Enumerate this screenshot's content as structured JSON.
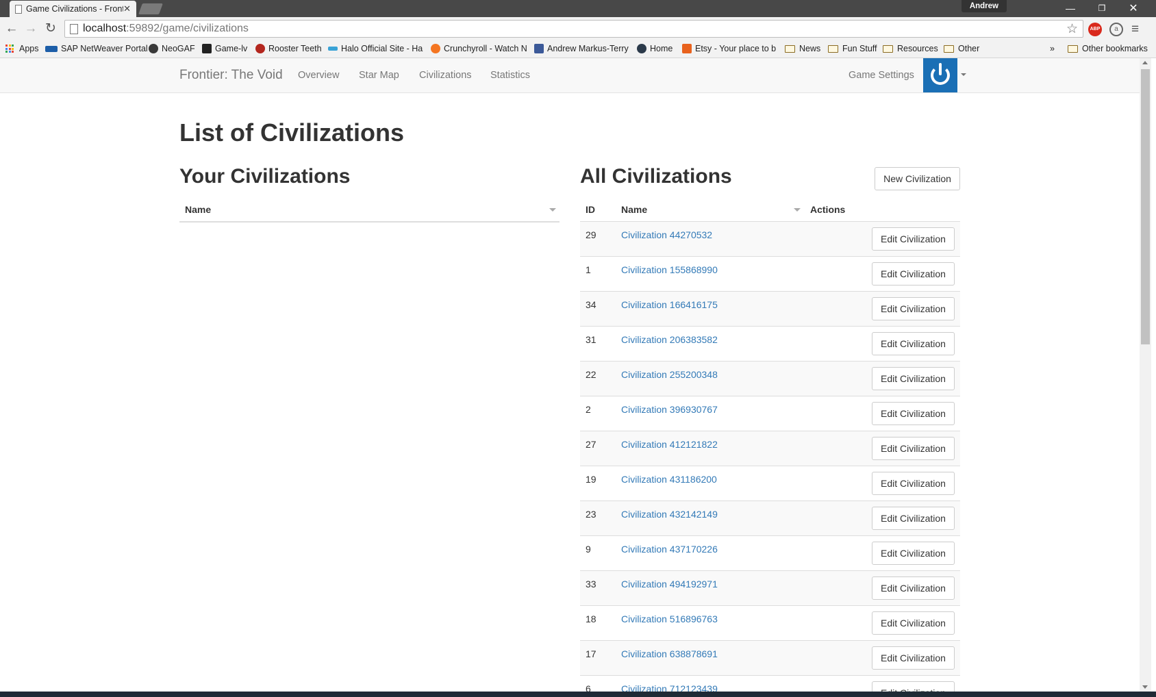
{
  "browser": {
    "tab_title": "Game Civilizations - Front",
    "user_name": "Andrew",
    "url_host": "localhost",
    "url_path": ":59892/game/civilizations",
    "bookmarks": [
      {
        "label": "Apps",
        "icon": "apps-grid-icon"
      },
      {
        "label": "SAP NetWeaver Portal",
        "icon": "sap-icon",
        "color": "#1d5ea8"
      },
      {
        "label": "NeoGAF",
        "icon": "neogaf-icon",
        "color": "#3a3a3a"
      },
      {
        "label": "Game-lv",
        "icon": "game-lv-icon",
        "color": "#222222"
      },
      {
        "label": "Rooster Teeth",
        "icon": "rooster-teeth-icon",
        "color": "#b3261e"
      },
      {
        "label": "Halo Official Site - Ha",
        "icon": "halo-icon",
        "color": "#3aa3d6"
      },
      {
        "label": "Crunchyroll - Watch N",
        "icon": "crunchyroll-icon",
        "color": "#f47521"
      },
      {
        "label": "Andrew Markus-Terry",
        "icon": "facebook-icon",
        "color": "#3b5998"
      },
      {
        "label": "Home",
        "icon": "home-site-icon",
        "color": "#2b3a4a"
      },
      {
        "label": "Etsy - Your place to b",
        "icon": "etsy-icon",
        "color": "#e8621d"
      },
      {
        "label": "News",
        "icon": "folder-icon"
      },
      {
        "label": "Fun Stuff",
        "icon": "folder-icon"
      },
      {
        "label": "Resources",
        "icon": "folder-icon"
      },
      {
        "label": "Other",
        "icon": "folder-icon"
      }
    ],
    "overflow_label": "»",
    "other_bookmarks": "Other bookmarks"
  },
  "nav": {
    "brand": "Frontier: The Void",
    "links": [
      "Overview",
      "Star Map",
      "Civilizations",
      "Statistics"
    ],
    "game_settings": "Game Settings",
    "accent_color": "#1a6fb5"
  },
  "page": {
    "title": "List of Civilizations",
    "your_civs": {
      "title": "Your Civilizations",
      "columns": [
        "Name"
      ]
    },
    "all_civs": {
      "title": "All Civilizations",
      "new_button": "New Civilization",
      "columns": [
        "ID",
        "Name",
        "Actions"
      ],
      "edit_label": "Edit Civilization",
      "rows": [
        {
          "id": "29",
          "name": "Civilization 44270532"
        },
        {
          "id": "1",
          "name": "Civilization 155868990"
        },
        {
          "id": "34",
          "name": "Civilization 166416175"
        },
        {
          "id": "31",
          "name": "Civilization 206383582"
        },
        {
          "id": "22",
          "name": "Civilization 255200348"
        },
        {
          "id": "2",
          "name": "Civilization 396930767"
        },
        {
          "id": "27",
          "name": "Civilization 412121822"
        },
        {
          "id": "19",
          "name": "Civilization 431186200"
        },
        {
          "id": "23",
          "name": "Civilization 432142149"
        },
        {
          "id": "9",
          "name": "Civilization 437170226"
        },
        {
          "id": "33",
          "name": "Civilization 494192971"
        },
        {
          "id": "18",
          "name": "Civilization 516896763"
        },
        {
          "id": "17",
          "name": "Civilization 638878691"
        },
        {
          "id": "6",
          "name": "Civilization 712123439"
        }
      ]
    }
  }
}
